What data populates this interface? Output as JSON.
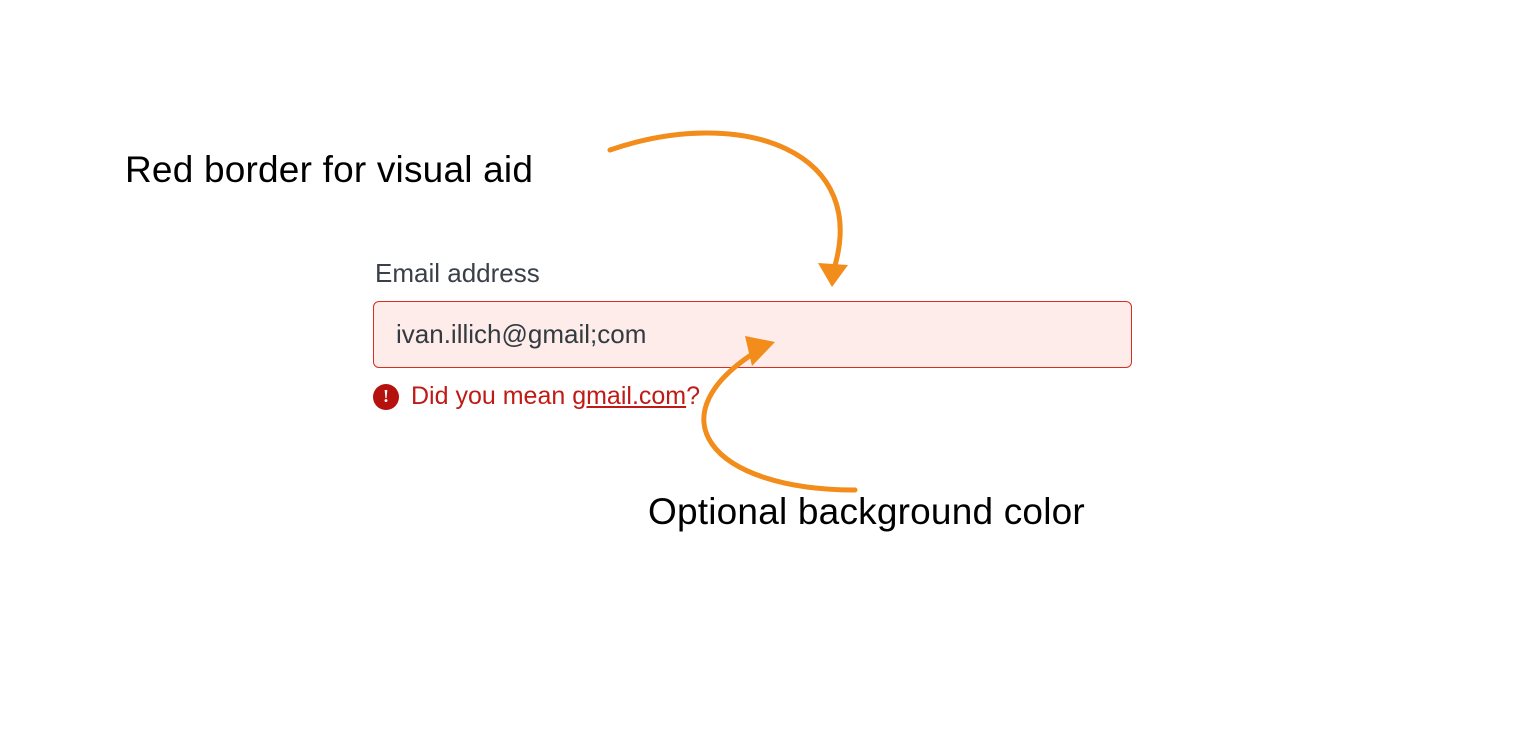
{
  "annotations": {
    "top": "Red border for visual aid",
    "bottom": "Optional background color"
  },
  "field": {
    "label": "Email address",
    "value": "ivan.illich@gmail;com"
  },
  "error": {
    "icon_name": "error-icon",
    "prefix": "Did you mean ",
    "suggestion": "gmail.com",
    "suffix": "?"
  },
  "colors": {
    "border": "#d92d20",
    "fill": "#fdece9",
    "error": "#c01a16",
    "arrow": "#f28c1a"
  }
}
